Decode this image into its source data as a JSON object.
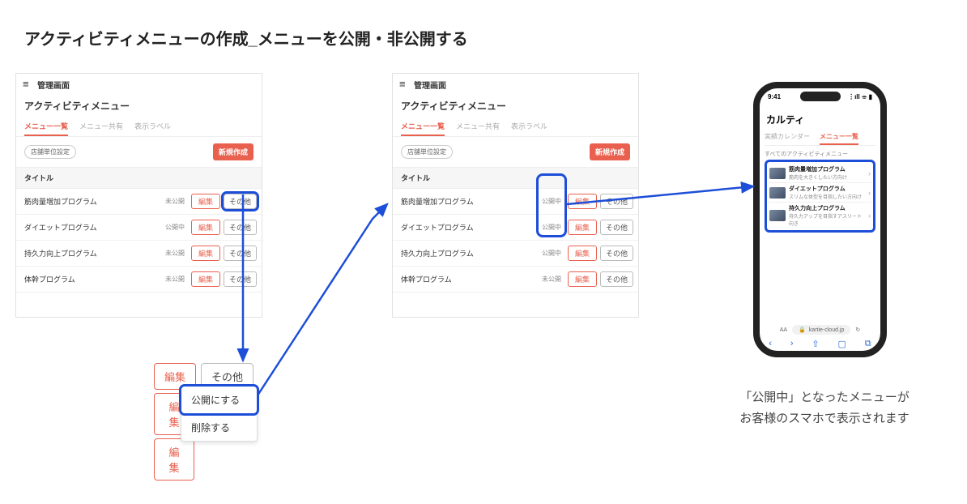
{
  "title": "アクティビティメニューの作成_メニューを公開・非公開する",
  "admin": {
    "window_title": "管理画面",
    "section_title": "アクティビティメニュー",
    "tabs": [
      "メニュー一覧",
      "メニュー共有",
      "表示ラベル"
    ],
    "chip": "店舗単位設定",
    "new_button": "新規作成",
    "col_title": "タイトル",
    "edit": "編集",
    "other": "その他"
  },
  "panel1_rows": [
    {
      "title": "筋肉量増加プログラム",
      "status": "未公開"
    },
    {
      "title": "ダイエットプログラム",
      "status": "公開中"
    },
    {
      "title": "持久力向上プログラム",
      "status": "未公開"
    },
    {
      "title": "体幹プログラム",
      "status": "未公開"
    }
  ],
  "panel2_rows": [
    {
      "title": "筋肉量増加プログラム",
      "status": "公開中"
    },
    {
      "title": "ダイエットプログラム",
      "status": "公開中"
    },
    {
      "title": "持久力向上プログラム",
      "status": "公開中"
    },
    {
      "title": "体幹プログラム",
      "status": "未公開"
    }
  ],
  "popover": {
    "edit": "編集",
    "other": "その他",
    "publish": "公開にする",
    "delete": "削除する"
  },
  "phone": {
    "time": "9:41",
    "signal": "⋮ıll ⌯ ▮",
    "app_title": "カルティ",
    "tabs": [
      "実績カレンダー",
      "メニュー一覧"
    ],
    "sub": "すべてのアクティビティメニュー",
    "items": [
      {
        "title": "筋肉量増加プログラム",
        "desc": "筋肉を大きくしたい方向け"
      },
      {
        "title": "ダイエットプログラム",
        "desc": "スリムな体型を目指したい方向け"
      },
      {
        "title": "持久力向上プログラム",
        "desc": "持久力アップを目指すアスリート向き"
      }
    ],
    "aa": "AA",
    "lock": "🔒",
    "url": "kartie-cloud.jp",
    "reload": "↻",
    "nav": [
      "‹",
      "›",
      "⇧",
      "▢",
      "⧉"
    ]
  },
  "caption_l1": "「公開中」となったメニューが",
  "caption_l2": "お客様のスマホで表示されます"
}
